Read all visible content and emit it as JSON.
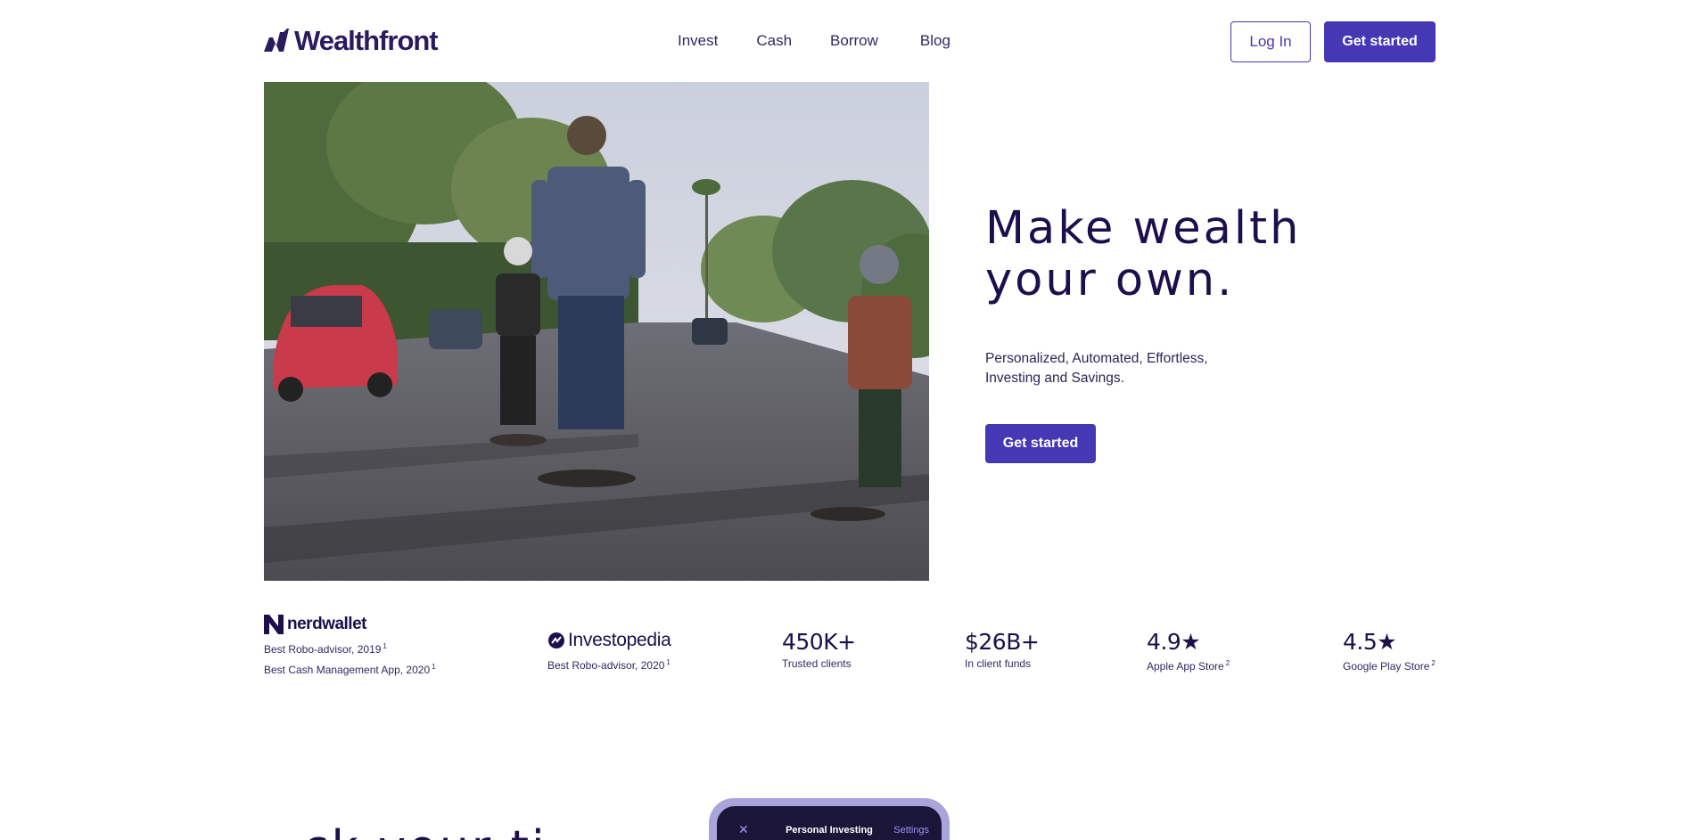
{
  "brand": {
    "name": "Wealthfront",
    "color": "#4637b5",
    "text_color": "#1c0f4c"
  },
  "nav": {
    "items": [
      {
        "label": "Invest"
      },
      {
        "label": "Cash"
      },
      {
        "label": "Borrow"
      },
      {
        "label": "Blog"
      }
    ],
    "login_label": "Log In",
    "get_started_label": "Get started"
  },
  "hero": {
    "title_line1": "Make wealth",
    "title_line2": "your own.",
    "subtitle_line1": "Personalized, Automated, Effortless,",
    "subtitle_line2": "Investing and Savings.",
    "cta_label": "Get started",
    "media_icon": "family-skateboarding-video"
  },
  "press": [
    {
      "logo": "nerdwallet",
      "logo_icon": "nerdwallet-n-icon",
      "awards": [
        {
          "text": "Best Robo-advisor, 2019",
          "note": "1"
        },
        {
          "text": "Best Cash Management App, 2020",
          "note": "1"
        }
      ]
    },
    {
      "logo": "Investopedia",
      "logo_icon": "investopedia-icon",
      "awards": [
        {
          "text": "Best Robo-advisor, 2020",
          "note": "1"
        }
      ]
    }
  ],
  "stats": [
    {
      "value": "450K+",
      "label": "Trusted clients",
      "note": ""
    },
    {
      "value": "$26B+",
      "label": "In client funds",
      "note": ""
    },
    {
      "value": "4.9★",
      "label": "Apple App Store",
      "note": "2"
    },
    {
      "value": "4.5★",
      "label": "Google Play Store",
      "note": "2"
    }
  ],
  "next_section": {
    "heading_partial": "ck your ti",
    "phone": {
      "close_icon": "close-icon",
      "title": "Personal Investing",
      "settings_label": "Settings"
    }
  }
}
